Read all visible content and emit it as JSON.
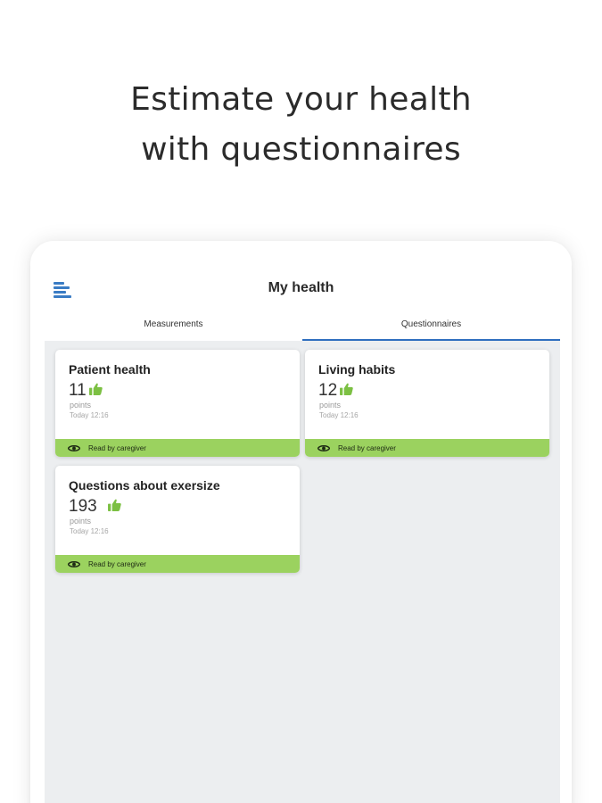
{
  "promo": {
    "line1": "Estimate your health",
    "line2": "with questionnaires"
  },
  "appbar": {
    "title": "My health",
    "menu_icon": "menu-icon"
  },
  "tabs": [
    {
      "label": "Measurements",
      "active": false
    },
    {
      "label": "Questionnaires",
      "active": true
    }
  ],
  "cards": [
    {
      "title": "Patient health",
      "score": "11",
      "unit": "points",
      "time": "Today 12:16",
      "status": "Read by caregiver",
      "icon": "thumbs-up-icon"
    },
    {
      "title": "Living habits",
      "score": "12",
      "unit": "points",
      "time": "Today 12:16",
      "status": "Read by caregiver",
      "icon": "thumbs-up-icon"
    },
    {
      "title": "Questions about exersize",
      "score": "193",
      "unit": "points",
      "time": "Today 12:16",
      "status": "Read by caregiver",
      "icon": "thumbs-up-icon"
    }
  ],
  "colors": {
    "accent": "#2f6fbf",
    "status_green": "#9bd25f",
    "thumb_green": "#7cc043",
    "content_bg": "#eceef0"
  }
}
